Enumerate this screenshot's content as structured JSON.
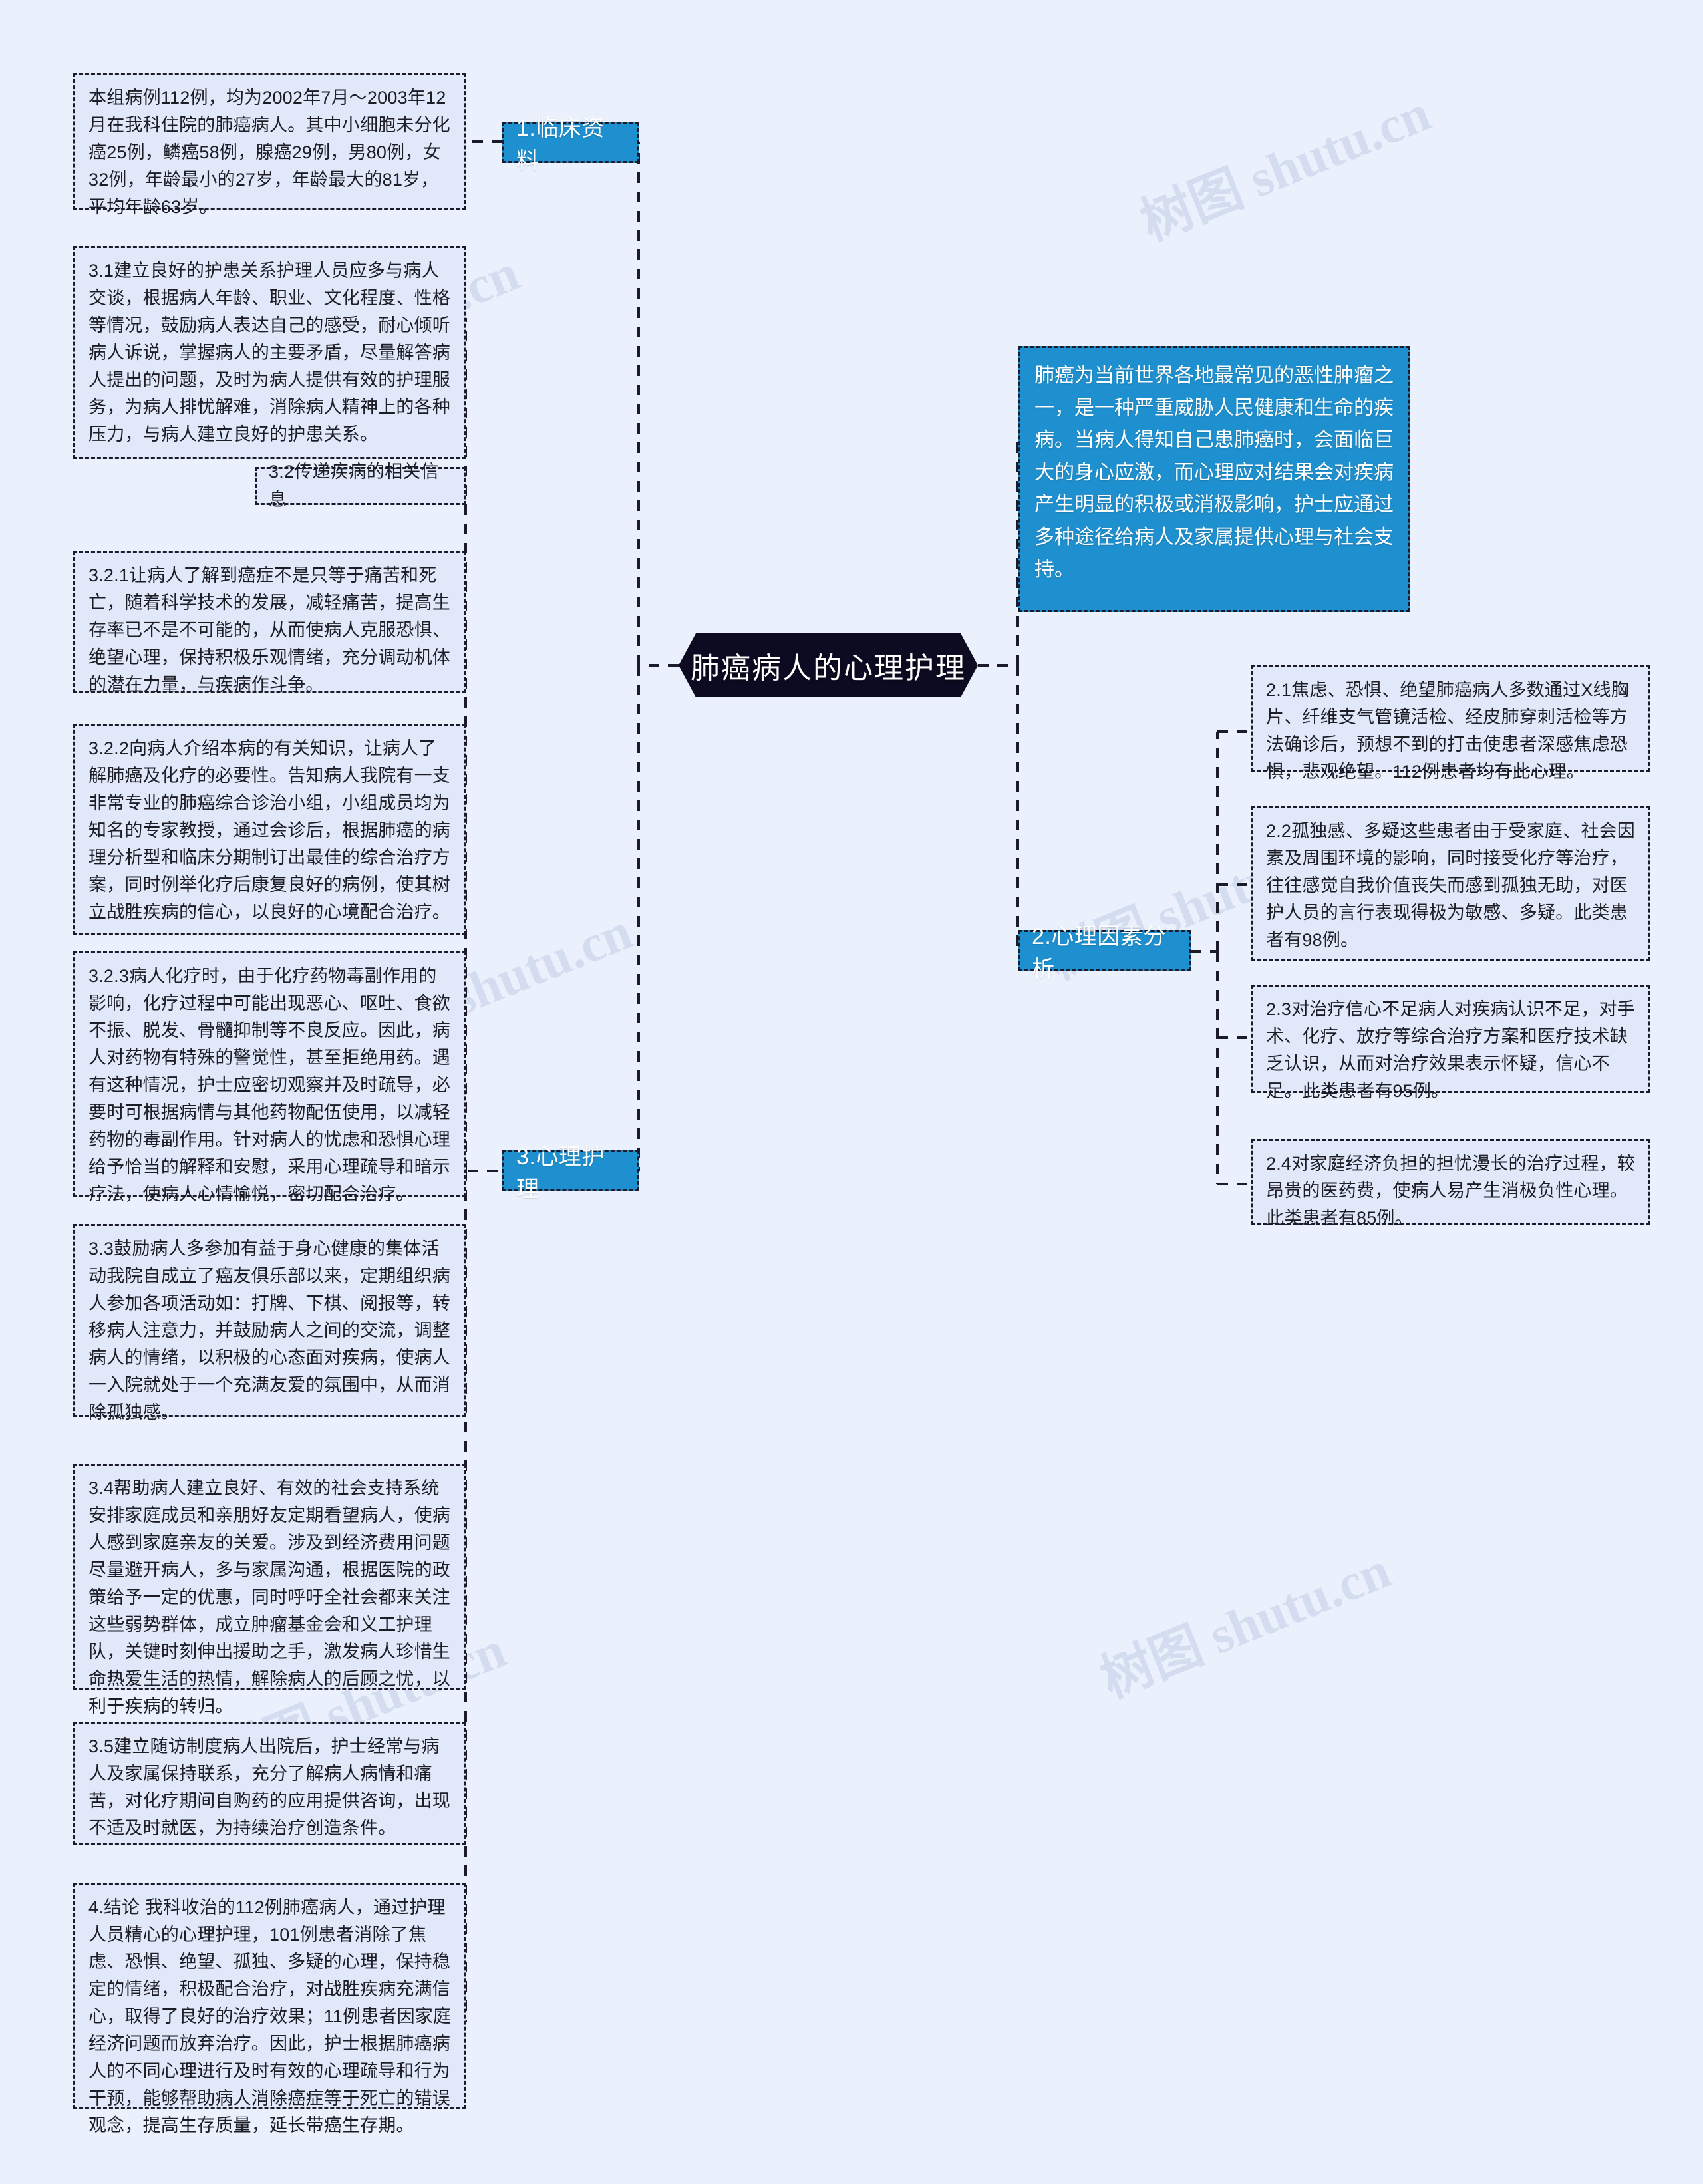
{
  "root": {
    "label": "肺癌病人的心理护理"
  },
  "watermarks": [
    "树图 shutu.cn",
    "树图 shutu.cn",
    "树图 shutu.cn",
    "树图 shutu.cn",
    "树图 shutu.cn",
    "树图 shutu.cn"
  ],
  "colors": {
    "background": "#eaf1fd",
    "root_fill": "#0d0b22",
    "branch_fill": "#1f90cf",
    "leaf_fill": "#e0e8fa",
    "border": "#1b1b2b",
    "leaf_text": "#1d1d26",
    "branch_text": "#ffffff"
  },
  "branches": [
    {
      "id": "branch-1",
      "label": "1.临床资料",
      "children": [
        {
          "id": "leaf-1-1",
          "text": "本组病例112例，均为2002年7月～2003年12月在我科住院的肺癌病人。其中小细胞未分化癌25例，鳞癌58例，腺癌29例，男80例，女32例，年龄最小的27岁，年龄最大的81岁，平均年龄63岁。"
        }
      ]
    },
    {
      "id": "branch-2",
      "label": "2.心理因素分析",
      "children": [
        {
          "id": "leaf-2-1",
          "text": "2.1焦虑、恐惧、绝望肺癌病人多数通过X线胸片、纤维支气管镜活检、经皮肺穿刺活检等方法确诊后，预想不到的打击使患者深感焦虑恐惧，悲观绝望。112例患者均有此心理。"
        },
        {
          "id": "leaf-2-2",
          "text": "2.2孤独感、多疑这些患者由于受家庭、社会因素及周围环境的影响，同时接受化疗等治疗，往往感觉自我价值丧失而感到孤独无助，对医护人员的言行表现得极为敏感、多疑。此类患者有98例。"
        },
        {
          "id": "leaf-2-3",
          "text": "2.3对治疗信心不足病人对疾病认识不足，对手术、化疗、放疗等综合治疗方案和医疗技术缺乏认识，从而对治疗效果表示怀疑，信心不足。此类患者有95例。"
        },
        {
          "id": "leaf-2-4",
          "text": "2.4对家庭经济负担的担忧漫长的治疗过程，较昂贵的医药费，使病人易产生消极负性心理。此类患者有85例。"
        }
      ]
    },
    {
      "id": "branch-3",
      "label": "3.心理护理",
      "children": [
        {
          "id": "leaf-3-1",
          "text": "3.1建立良好的护患关系护理人员应多与病人交谈，根据病人年龄、职业、文化程度、性格等情况，鼓励病人表达自己的感受，耐心倾听病人诉说，掌握病人的主要矛盾，尽量解答病人提出的问题，及时为病人提供有效的护理服务，为病人排忧解难，消除病人精神上的各种压力，与病人建立良好的护患关系。"
        },
        {
          "id": "leaf-3-2",
          "text": "3.2传递疾病的相关信息"
        },
        {
          "id": "leaf-3-2-1",
          "text": "3.2.1让病人了解到癌症不是只等于痛苦和死亡，随着科学技术的发展，减轻痛苦，提高生存率已不是不可能的，从而使病人克服恐惧、绝望心理，保持积极乐观情绪，充分调动机体的潜在力量，与疾病作斗争。"
        },
        {
          "id": "leaf-3-2-2",
          "text": "3.2.2向病人介绍本病的有关知识，让病人了解肺癌及化疗的必要性。告知病人我院有一支非常专业的肺癌综合诊治小组，小组成员均为知名的专家教授，通过会诊后，根据肺癌的病理分析型和临床分期制订出最佳的综合治疗方案，同时例举化疗后康复良好的病例，使其树立战胜疾病的信心，以良好的心境配合治疗。"
        },
        {
          "id": "leaf-3-2-3",
          "text": "3.2.3病人化疗时，由于化疗药物毒副作用的影响，化疗过程中可能出现恶心、呕吐、食欲不振、脱发、骨髓抑制等不良反应。因此，病人对药物有特殊的警觉性，甚至拒绝用药。遇有这种情况，护士应密切观察并及时疏导，必要时可根据病情与其他药物配伍使用，以减轻药物的毒副作用。针对病人的忧虑和恐惧心理给予恰当的解释和安慰，采用心理疏导和暗示疗法，使病人心情愉悦，密切配合治疗。"
        },
        {
          "id": "leaf-3-3",
          "text": "3.3鼓励病人多参加有益于身心健康的集体活动我院自成立了癌友俱乐部以来，定期组织病人参加各项活动如：打牌、下棋、阅报等，转移病人注意力，并鼓励病人之间的交流，调整病人的情绪，以积极的心态面对疾病，使病人一入院就处于一个充满友爱的氛围中，从而消除孤独感。"
        },
        {
          "id": "leaf-3-4",
          "text": "3.4帮助病人建立良好、有效的社会支持系统安排家庭成员和亲朋好友定期看望病人，使病人感到家庭亲友的关爱。涉及到经济费用问题尽量避开病人，多与家属沟通，根据医院的政策给予一定的优惠，同时呼吁全社会都来关注这些弱势群体，成立肿瘤基金会和义工护理队，关键时刻伸出援助之手，激发病人珍惜生命热爱生活的热情，解除病人的后顾之忧，以利于疾病的转归。"
        },
        {
          "id": "leaf-3-5",
          "text": "3.5建立随访制度病人出院后，护士经常与病人及家属保持联系，充分了解病人病情和痛苦，对化疗期间自购药的应用提供咨询，出现不适及时就医，为持续治疗创造条件。"
        },
        {
          "id": "leaf-4",
          "text": "4.结论 我科收治的112例肺癌病人，通过护理人员精心的心理护理，101例患者消除了焦虑、恐惧、绝望、孤独、多疑的心理，保持稳定的情绪，积极配合治疗，对战胜疾病充满信心，取得了良好的治疗效果；11例患者因家庭经济问题而放弃治疗。因此，护士根据肺癌病人的不同心理进行及时有效的心理疏导和行为干预，能够帮助病人消除癌症等于死亡的错误观念，提高生存质量，延长带癌生存期。"
        }
      ]
    }
  ],
  "summary_note": {
    "id": "leaf-summary",
    "text": "肺癌为当前世界各地最常见的恶性肿瘤之一，是一种严重威胁人民健康和生命的疾病。当病人得知自己患肺癌时，会面临巨大的身心应激，而心理应对结果会对疾病产生明显的积极或消极影响，护士应通过多种途径给病人及家属提供心理与社会支持。"
  }
}
